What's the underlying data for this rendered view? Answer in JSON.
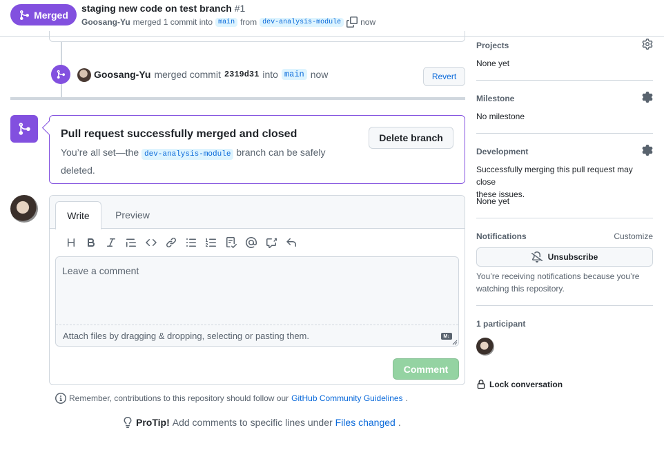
{
  "header": {
    "status_badge": "Merged",
    "title": "staging new code on test branch",
    "number": "#1",
    "author": "Goosang-Yu",
    "merged_text": "merged 1 commit into",
    "base_branch": "main",
    "from_text": "from",
    "head_branch": "dev-analysis-module",
    "time": "now"
  },
  "timeline": {
    "event": {
      "actor": "Goosang-Yu",
      "action": "merged commit",
      "sha": "2319d31",
      "into_text": "into",
      "branch": "main",
      "time": "now",
      "revert_label": "Revert"
    }
  },
  "merge_status": {
    "title": "Pull request successfully merged and closed",
    "desc_prefix": "You’re all set—the",
    "branch": "dev-analysis-module",
    "desc_suffix": "branch can be safely",
    "desc_last": "deleted.",
    "delete_label": "Delete branch"
  },
  "comment": {
    "tab_write": "Write",
    "tab_preview": "Preview",
    "placeholder": "Leave a comment",
    "attach_text": "Attach files by dragging & dropping, selecting or pasting them.",
    "markdown_badge": "M↓",
    "submit_label": "Comment",
    "toolbar_icons": [
      "heading-icon",
      "bold-icon",
      "italic-icon",
      "quote-icon",
      "code-icon",
      "link-icon",
      "unordered-list-icon",
      "ordered-list-icon",
      "task-list-icon",
      "mention-icon",
      "cross-reference-icon",
      "undo-icon"
    ]
  },
  "footer": {
    "guidelines_prefix": "Remember, contributions to this repository should follow our",
    "guidelines_link": "GitHub Community Guidelines",
    "guidelines_suffix": ".",
    "protip_label": "ProTip!",
    "protip_text": "Add comments to specific lines under",
    "protip_link": "Files changed",
    "protip_suffix": "."
  },
  "sidebar": {
    "projects": {
      "label": "Projects",
      "value": "None yet"
    },
    "milestone": {
      "label": "Milestone",
      "value": "No milestone"
    },
    "development": {
      "label": "Development",
      "desc_line1": "Successfully merging this pull request may close",
      "desc_line2": "these issues.",
      "value": "None yet"
    },
    "notifications": {
      "label": "Notifications",
      "customize": "Customize",
      "button": "Unsubscribe",
      "note_line1": "You’re receiving notifications because you’re",
      "note_line2": "watching this repository."
    },
    "participants": {
      "label": "1 participant"
    },
    "lock": {
      "label": "Lock conversation"
    }
  },
  "colors": {
    "merged_purple": "#8250df",
    "link_blue": "#0969da",
    "comment_btn_disabled": "#94d3a2",
    "border": "#d0d7de",
    "muted_text": "#59636e"
  }
}
